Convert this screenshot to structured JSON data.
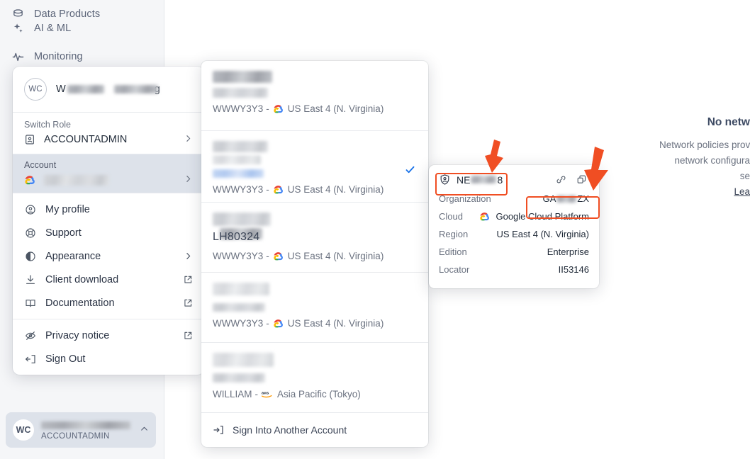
{
  "sidebar": {
    "items": [
      {
        "label": "Data Products",
        "icon": "database-icon"
      },
      {
        "label": "AI & ML",
        "icon": "sparkle-icon"
      },
      {
        "label": "Monitoring",
        "icon": "activity-icon"
      }
    ],
    "user_badge": {
      "initials": "WC",
      "name_redacted": true,
      "role": "ACCOUNTADMIN",
      "chevron": "chevron-up-icon"
    }
  },
  "user_menu": {
    "avatar_initials": "WC",
    "user_name_prefix": "W",
    "user_name_suffix": "g",
    "switch_role_label": "Switch Role",
    "role_value": "ACCOUNTADMIN",
    "account_label": "Account",
    "items": [
      {
        "label": "My profile",
        "icon": "user-circle-icon",
        "trailing": ""
      },
      {
        "label": "Support",
        "icon": "lifebuoy-icon",
        "trailing": ""
      },
      {
        "label": "Appearance",
        "icon": "contrast-icon",
        "trailing": "chevron-right-icon"
      },
      {
        "label": "Client download",
        "icon": "download-icon",
        "trailing": "external-link-icon"
      },
      {
        "label": "Documentation",
        "icon": "book-icon",
        "trailing": "external-link-icon"
      }
    ],
    "items2": [
      {
        "label": "Privacy notice",
        "icon": "eye-off-icon",
        "trailing": "external-link-icon"
      },
      {
        "label": "Sign Out",
        "icon": "sign-out-icon",
        "trailing": ""
      }
    ]
  },
  "account_list": {
    "accounts": [
      {
        "org": "WWWY3Y3",
        "cloud": "gcp",
        "region": "US East 4 (N. Virginia)",
        "selected": false,
        "name_redacted": true,
        "sub_redacted": true
      },
      {
        "org": "WWWY3Y3",
        "cloud": "gcp",
        "region": "US East 4 (N. Virginia)",
        "selected": true,
        "name_redacted": true,
        "sub_redacted": true
      },
      {
        "org": "WWWY3Y3",
        "cloud": "gcp",
        "region": "US East 4 (N. Virginia)",
        "selected": false,
        "name_redacted": true,
        "sub_redacted": true
      },
      {
        "org": "WWWY3Y3",
        "cloud": "gcp",
        "region": "US East 4 (N. Virginia)",
        "selected": false,
        "name_redacted": true,
        "sub_redacted": true
      },
      {
        "org": "WILLIAM",
        "cloud": "aws",
        "region": "Asia Pacific (Tokyo)",
        "selected": false,
        "name_redacted": true,
        "sub_redacted": true
      }
    ],
    "separator": "-",
    "sign_into_another_label": "Sign Into Another Account",
    "sign_into_another_icon": "sign-in-icon",
    "check_icon": "check-icon",
    "check_color": "#1a73e8"
  },
  "account_detail": {
    "name_prefix": "NE",
    "name_suffix": "8",
    "shield_icon": "shield-user-icon",
    "link_icon": "link-icon",
    "copy_icon": "copy-icon",
    "rows": [
      {
        "key": "Organization",
        "value_prefix": "GA",
        "value_suffix": "ZX",
        "redacted": true,
        "icon": ""
      },
      {
        "key": "Cloud",
        "value": "Google Cloud Platform",
        "icon": "gcp-icon"
      },
      {
        "key": "Region",
        "value": "US East 4 (N. Virginia)",
        "icon": ""
      },
      {
        "key": "Edition",
        "value": "Enterprise",
        "icon": ""
      },
      {
        "key": "Locator",
        "value": "II53146",
        "icon": ""
      }
    ]
  },
  "annotations": {
    "color": "#f04e23",
    "arrows": [
      {
        "name": "arrow-to-account-name"
      },
      {
        "name": "arrow-to-organization"
      }
    ],
    "highlights": [
      {
        "name": "highlight-account-name"
      },
      {
        "name": "highlight-organization"
      }
    ]
  },
  "right_panel": {
    "icon": "shield-outline-icon",
    "title": "No netw",
    "body_line1": "Network policies prov",
    "body_line2": "network configura",
    "body_line3": "se",
    "link": "Lea"
  }
}
